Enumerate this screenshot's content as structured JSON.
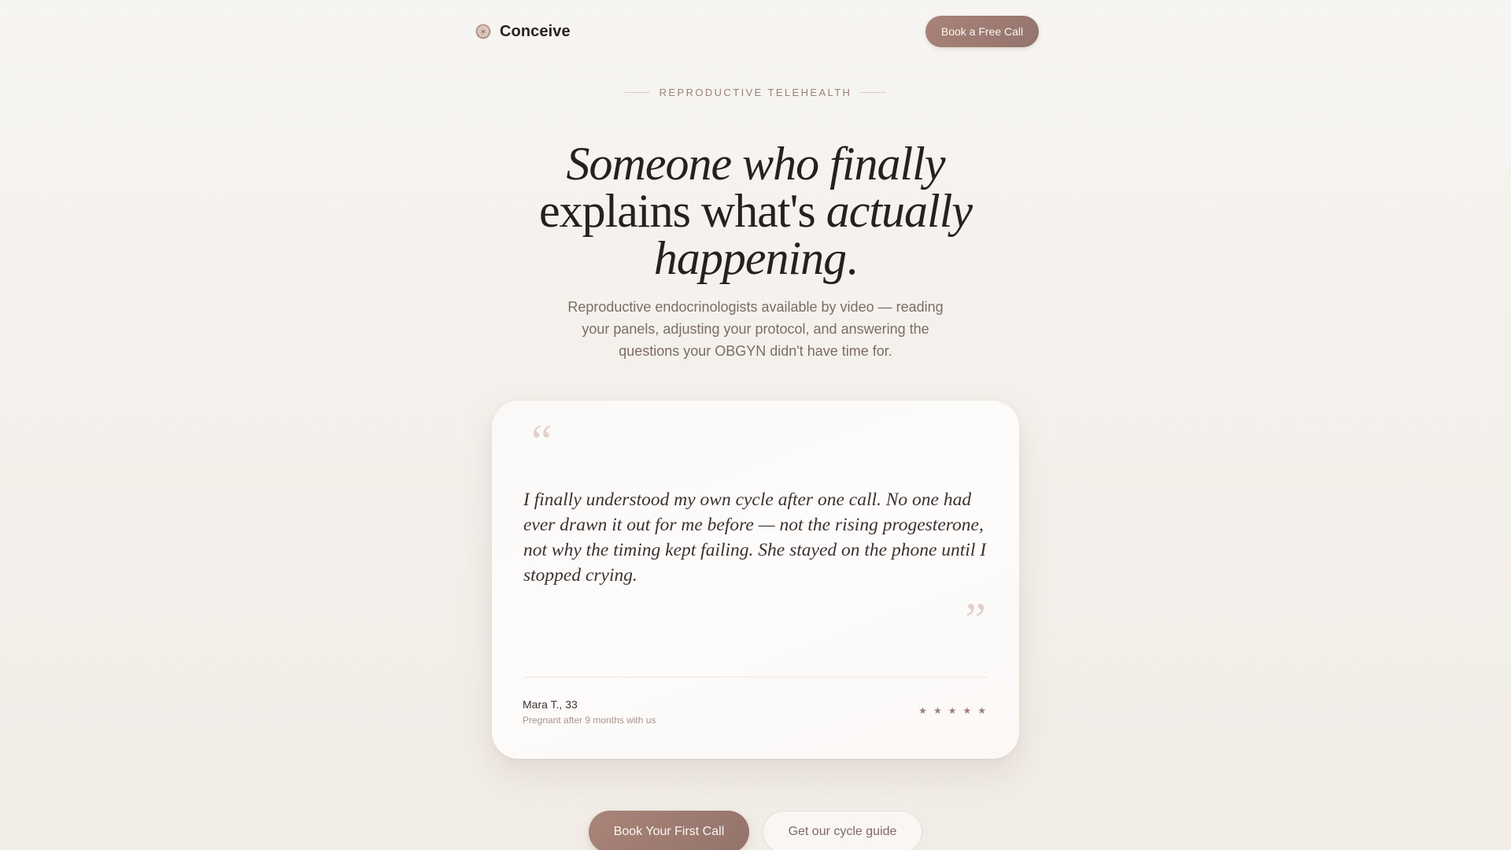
{
  "brand": {
    "name": "Conceive",
    "icon": "cell-logo-icon"
  },
  "nav": {
    "cta_label": "Book a Free Call"
  },
  "hero": {
    "eyebrow": "REPRODUCTIVE TELEHEALTH",
    "headline_part1": "Someone who finally",
    "headline_part2": "explains what's ",
    "headline_part3": "actually",
    "headline_part4": "happening",
    "headline_part5": ".",
    "subhead": "Reproductive endocrinologists available by video — reading your panels, adjusting your protocol, and answering the questions your OBGYN didn't have time for."
  },
  "testimonial": {
    "open_quote": "“",
    "close_quote": "”",
    "quote": "I finally understood my own cycle after one call. No one had ever drawn it out for me before — not the rising progesterone, not why the timing kept failing. She stayed on the phone until I stopped crying.",
    "author": "Mara T., 33",
    "author_detail": "Pregnant after 9 months with us",
    "rating": 5,
    "star_glyph": "★"
  },
  "actions": {
    "primary_label": "Book Your First Call",
    "secondary_label": "Get our cycle guide"
  },
  "colors": {
    "accent": "#a07f75",
    "background": "#f5f2ee",
    "text_primary": "#262120",
    "text_muted": "#7c6b63"
  }
}
